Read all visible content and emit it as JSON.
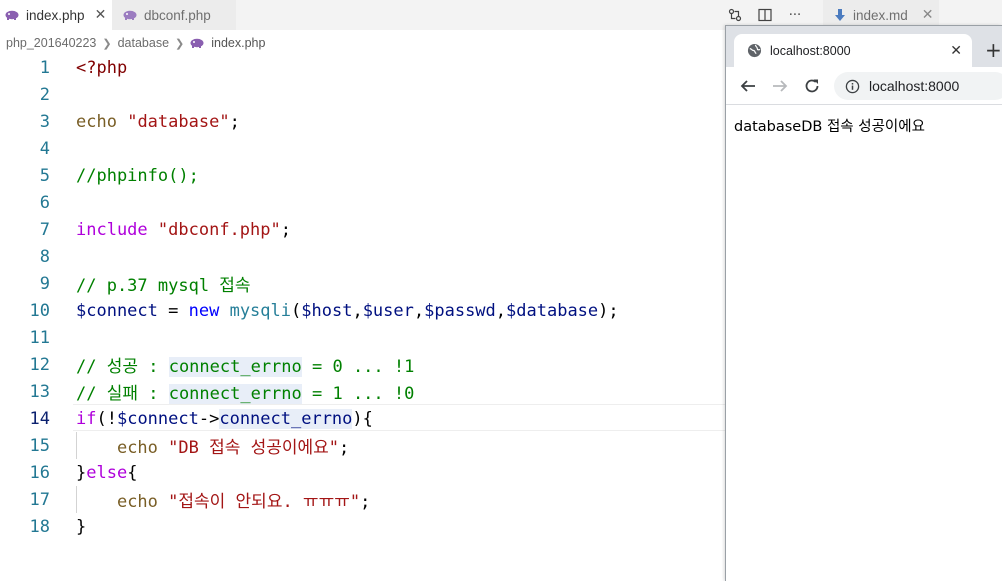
{
  "editor": {
    "tabs": [
      {
        "label": "index.php",
        "close": "✕"
      },
      {
        "label": "dbconf.php"
      }
    ],
    "right_tab": {
      "label": "index.md",
      "close": "✕"
    },
    "actions": {
      "more": "···"
    },
    "breadcrumb": [
      "php_201640223",
      "database",
      "index.php"
    ],
    "line_numbers": [
      "1",
      "2",
      "3",
      "4",
      "5",
      "6",
      "7",
      "8",
      "9",
      "10",
      "11",
      "12",
      "13",
      "14",
      "15",
      "16",
      "17",
      "18"
    ],
    "active_line": "14",
    "code": {
      "l1": {
        "open_tag": "<?php"
      },
      "l3": {
        "kw": "echo",
        "sp": " ",
        "str": "\"database\"",
        "end": ";"
      },
      "l5": {
        "comment": "//phpinfo();"
      },
      "l7": {
        "kw": "include",
        "sp": " ",
        "str": "\"dbconf.php\"",
        "end": ";"
      },
      "l9": {
        "comment": "// p.37 mysql 접속"
      },
      "l10": {
        "var1": "$connect",
        "op": " = ",
        "kw": "new",
        "sp": " ",
        "cls": "mysqli",
        "p1": "(",
        "a1": "$host",
        "c1": ",",
        "a2": "$user",
        "c2": ",",
        "a3": "$passwd",
        "c3": ",",
        "a4": "$database",
        "p2": ");"
      },
      "l12": {
        "c1": "// 성공 : ",
        "hl": "connect_errno",
        "c2": " = 0 ... !1"
      },
      "l13": {
        "c1": "// 실패 : ",
        "hl": "connect_errno",
        "c2": " = 1 ... !0"
      },
      "l14": {
        "kw": "if",
        "p1": "(!",
        "var": "$connect",
        "arrow": "->",
        "prop": "connect_errno",
        "p2": "){"
      },
      "l15": {
        "indent": "    ",
        "kw": "echo",
        "sp": " ",
        "str": "\"DB 접속 성공이에요\"",
        "end": ";"
      },
      "l16": {
        "b1": "}",
        "kw": "else",
        "b2": "{"
      },
      "l17": {
        "indent": "    ",
        "kw": "echo",
        "sp": " ",
        "str": "\"접속이 안되요. ㅠㅠㅠ\"",
        "end": ";"
      },
      "l18": {
        "b1": "}"
      }
    }
  },
  "browser": {
    "tab_title": "localhost:8000",
    "tab_close": "✕",
    "new_tab": "+",
    "url": "localhost:8000",
    "content": "databaseDB 접속 성공이에요"
  },
  "colors": {
    "line_number": "#237893",
    "comment": "#008000",
    "string": "#a31515",
    "keyword": "#0000ff",
    "variable": "#001080",
    "php_tag": "#800000",
    "control": "#af00db"
  }
}
